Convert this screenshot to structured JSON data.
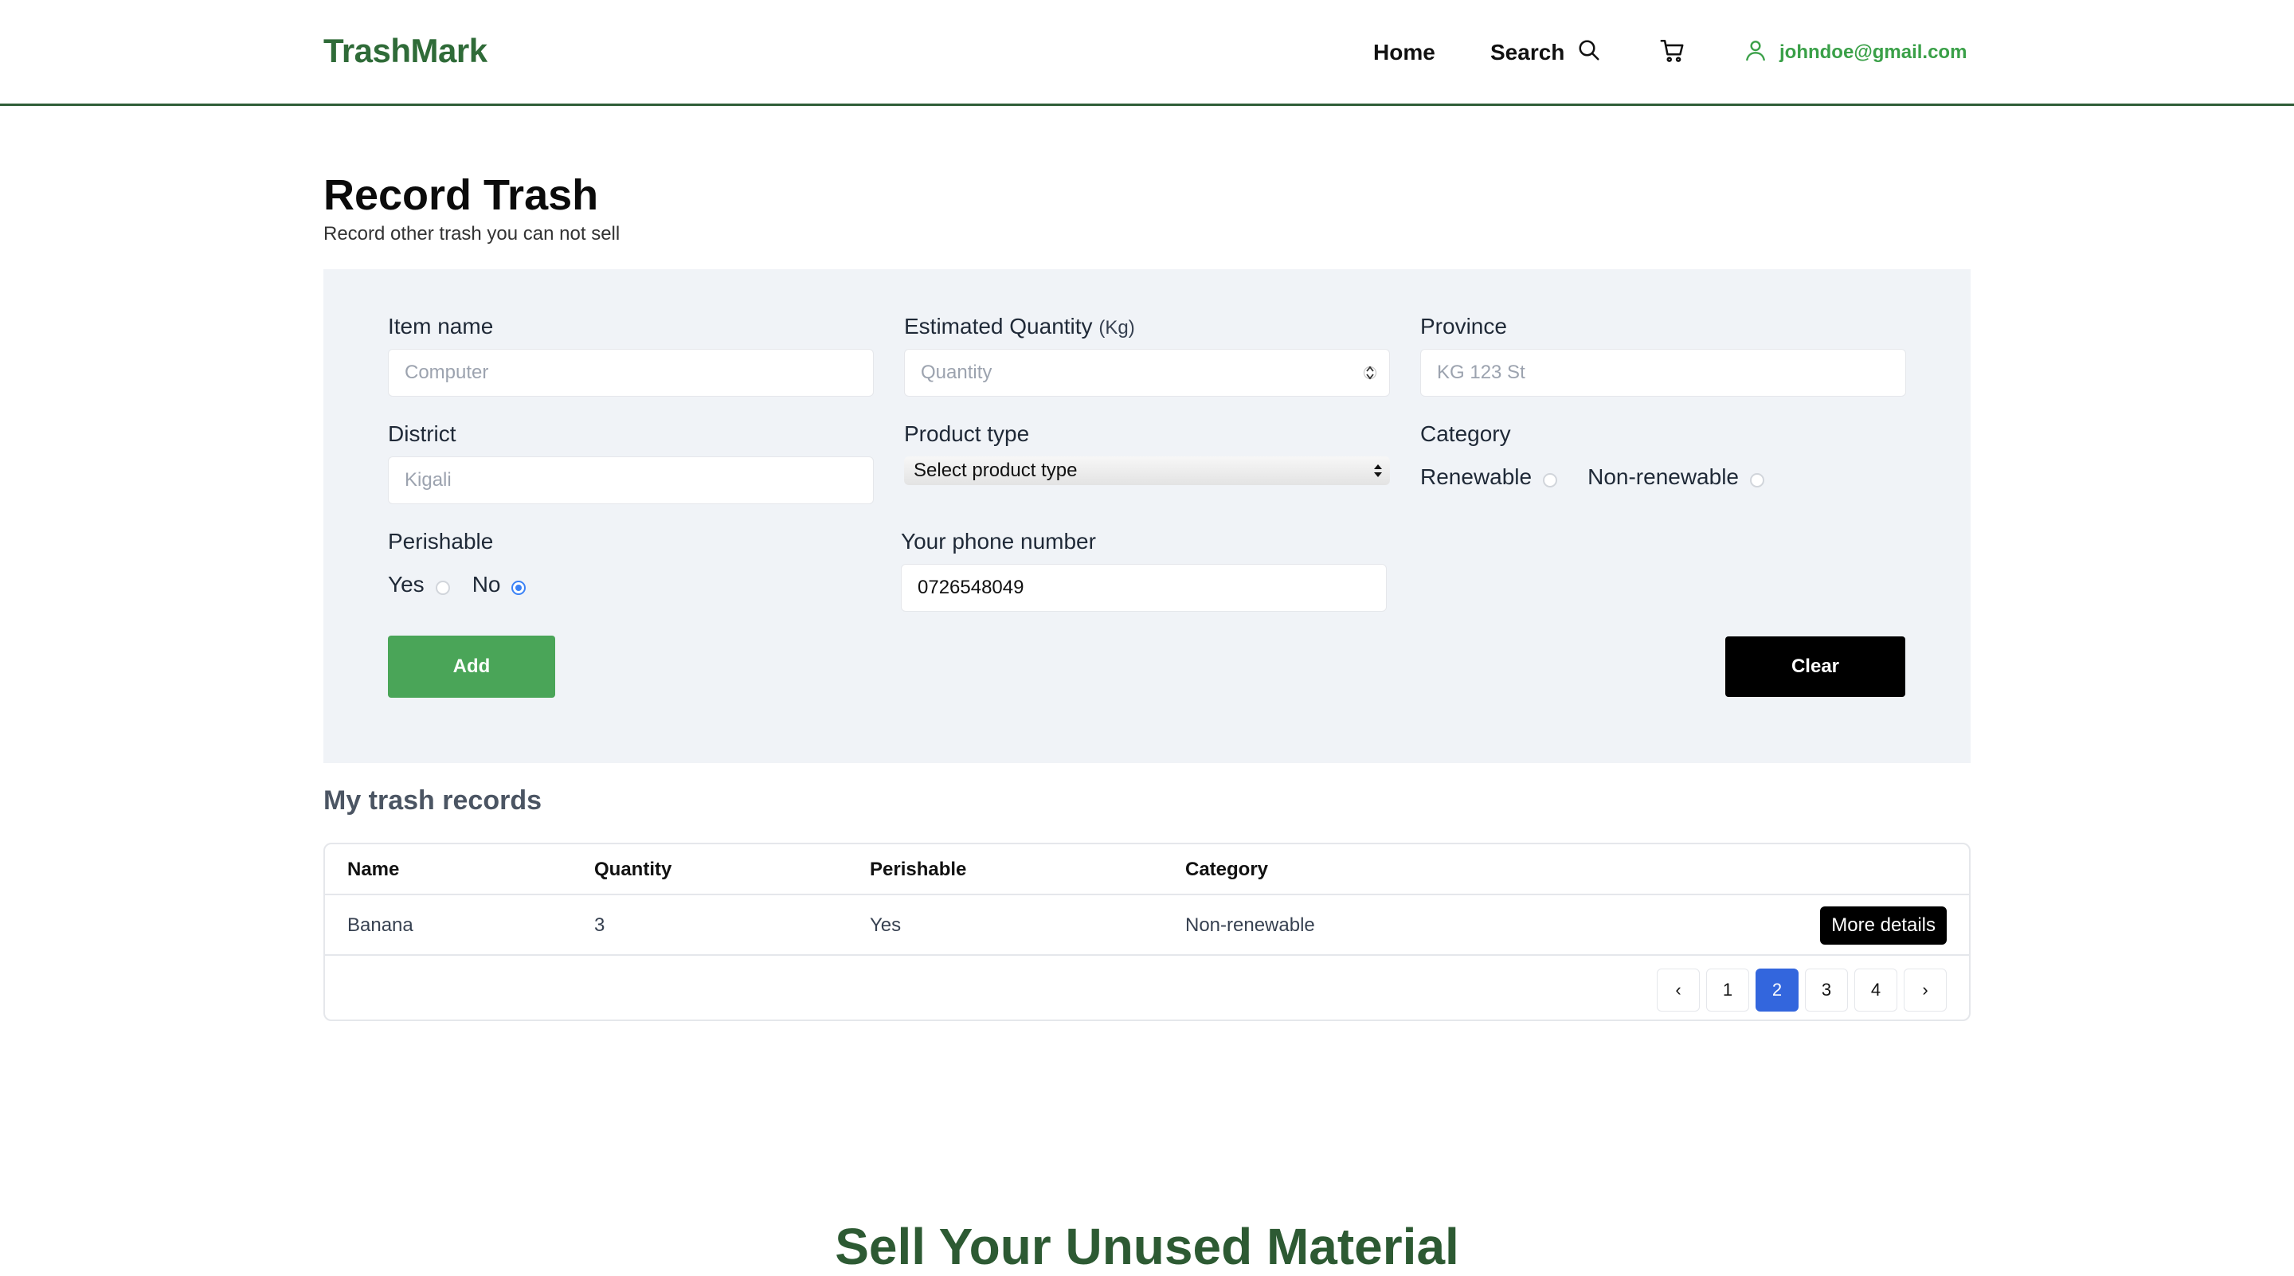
{
  "header": {
    "brand": "TrashMark",
    "nav_home": "Home",
    "nav_search": "Search",
    "user_email": "johndoe@gmail.com"
  },
  "page": {
    "title": "Record Trash",
    "subtitle": "Record other trash you can not sell"
  },
  "form": {
    "item_name": {
      "label": "Item name",
      "placeholder": "Computer"
    },
    "quantity": {
      "label": "Estimated Quantity",
      "unit": "(Kg)",
      "placeholder": "Quantity"
    },
    "province": {
      "label": "Province",
      "placeholder": "KG 123 St"
    },
    "district": {
      "label": "District",
      "placeholder": "Kigali"
    },
    "product_type": {
      "label": "Product type",
      "selected": "Select product type"
    },
    "category": {
      "label": "Category",
      "options": [
        "Renewable",
        "Non-renewable"
      ],
      "selected": null
    },
    "perishable": {
      "label": "Perishable",
      "options": [
        "Yes",
        "No"
      ],
      "selected": "No"
    },
    "phone": {
      "label": "Your phone number",
      "value": "0726548049"
    },
    "add_label": "Add",
    "clear_label": "Clear"
  },
  "records": {
    "title": "My trash records",
    "columns": [
      "Name",
      "Quantity",
      "Perishable",
      "Category"
    ],
    "rows": [
      {
        "name": "Banana",
        "quantity": "3",
        "perishable": "Yes",
        "category": "Non-renewable",
        "action": "More details"
      }
    ],
    "pagination": {
      "prev": "‹",
      "next": "›",
      "pages": [
        "1",
        "2",
        "3",
        "4"
      ],
      "current": "2"
    }
  },
  "sell_section": {
    "heading": "Sell Your Unused Material"
  },
  "colors": {
    "brand": "#2f6b38",
    "user_link": "#3aa048",
    "add_button": "#4aa558",
    "active_page": "#3366dd",
    "panel_bg": "#f0f3f7"
  },
  "icons": {
    "search": "search-icon",
    "cart": "cart-icon",
    "user": "user-icon"
  }
}
